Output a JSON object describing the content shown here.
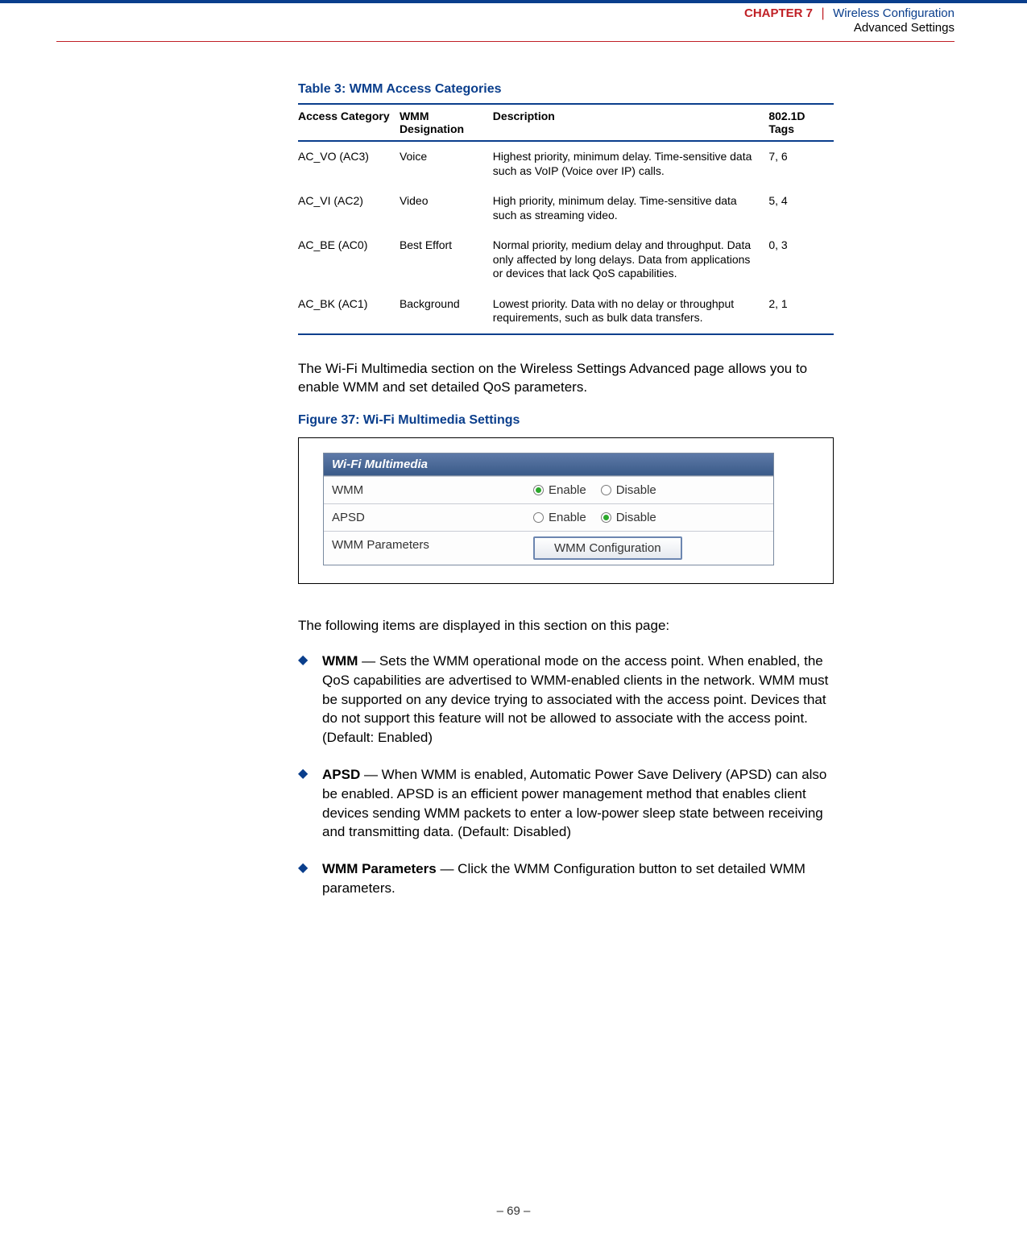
{
  "header": {
    "chapter_label": "CHAPTER 7",
    "divider": "|",
    "chapter_title": "Wireless Configuration",
    "subtitle": "Advanced Settings"
  },
  "table": {
    "title": "Table 3: WMM Access Categories",
    "headers": {
      "c0": "Access Category",
      "c1": "WMM Designation",
      "c2": "Description",
      "c3": "802.1D Tags"
    },
    "rows": [
      {
        "c0": "AC_VO (AC3)",
        "c1": "Voice",
        "c2": "Highest priority, minimum delay. Time-sensitive data such as VoIP (Voice over IP) calls.",
        "c3": "7, 6"
      },
      {
        "c0": "AC_VI (AC2)",
        "c1": "Video",
        "c2": "High priority, minimum delay. Time-sensitive data such as streaming video.",
        "c3": "5, 4"
      },
      {
        "c0": "AC_BE (AC0)",
        "c1": "Best Effort",
        "c2": "Normal priority, medium delay and throughput. Data only affected by long delays. Data from applications or devices that lack QoS capabilities.",
        "c3": "0, 3"
      },
      {
        "c0": "AC_BK (AC1)",
        "c1": "Background",
        "c2": "Lowest priority. Data with no delay or throughput requirements, such as bulk data transfers.",
        "c3": "2, 1"
      }
    ]
  },
  "intro_para": "The Wi-Fi Multimedia section on the Wireless Settings Advanced page allows you to enable WMM and set detailed QoS parameters.",
  "figure": {
    "title": "Figure 37:  Wi-Fi Multimedia Settings",
    "panel_header": "Wi-Fi Multimedia",
    "rows": {
      "wmm": {
        "label": "WMM",
        "enable": "Enable",
        "disable": "Disable",
        "selected": "enable"
      },
      "apsd": {
        "label": "APSD",
        "enable": "Enable",
        "disable": "Disable",
        "selected": "disable"
      },
      "params": {
        "label": "WMM Parameters",
        "button": "WMM Configuration"
      }
    }
  },
  "items_intro": "The following items are displayed in this section on this page:",
  "items": [
    {
      "term": "WMM",
      "text": " — Sets the WMM operational mode on the access point. When enabled, the QoS capabilities are advertised to WMM-enabled clients in the network. WMM must be supported on any device trying to associated with the access point. Devices that do not support this feature will not be allowed to associate with the access point. (Default: Enabled)"
    },
    {
      "term": "APSD",
      "text": " — When WMM is enabled, Automatic Power Save Delivery (APSD) can also be enabled. APSD is an efficient power management method that enables client devices sending WMM packets to enter a low-power sleep state between receiving and transmitting data. (Default: Disabled)"
    },
    {
      "term": "WMM Parameters",
      "text": " — Click the WMM Configuration button to set detailed WMM parameters."
    }
  ],
  "footer": "–  69  –"
}
